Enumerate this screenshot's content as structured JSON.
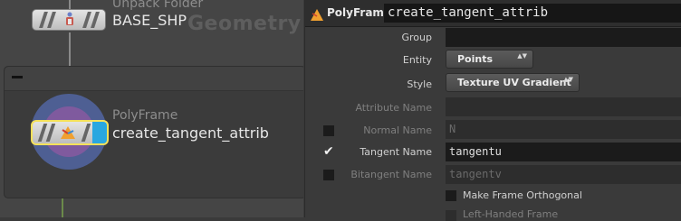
{
  "network": {
    "context_label": "Geometry",
    "upstream_node": {
      "type": "Unpack Folder",
      "name": "BASE_SHP"
    },
    "selected_node": {
      "type": "PolyFrame",
      "name": "create_tangent_attrib"
    }
  },
  "params": {
    "node_type": "PolyFrame",
    "node_name": "create_tangent_attrib",
    "group": {
      "label": "Group",
      "value": ""
    },
    "entity": {
      "label": "Entity",
      "value": "Points"
    },
    "style": {
      "label": "Style",
      "value": "Texture UV Gradient"
    },
    "attribute_name": {
      "label": "Attribute Name",
      "value": ""
    },
    "normal_name": {
      "label": "Normal Name",
      "value": "N",
      "checked": false
    },
    "tangent_name": {
      "label": "Tangent Name",
      "value": "tangentu",
      "checked": true,
      "check_glyph": "✔"
    },
    "bitangent_name": {
      "label": "Bitangent Name",
      "value": "tangentv",
      "checked": false
    },
    "make_frame_orthogonal": {
      "label": "Make Frame Orthogonal",
      "checked": false
    },
    "left_handed_frame": {
      "label": "Left-Handed Frame",
      "checked": false
    },
    "menu_arrows": "▲▼",
    "accent_color": "#f0a030",
    "selection_color": "#f5e15a",
    "flag_color": "#29a7e0"
  }
}
